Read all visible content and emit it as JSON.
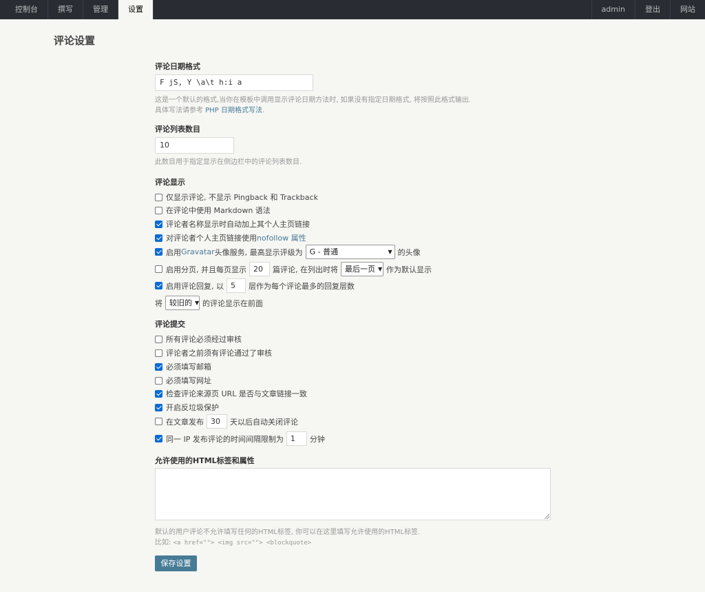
{
  "nav": {
    "left": [
      "控制台",
      "撰写",
      "管理",
      "设置"
    ],
    "right": [
      "admin",
      "登出",
      "网站"
    ]
  },
  "page_title": "评论设置",
  "date_format": {
    "title": "评论日期格式",
    "value": "F jS, Y \\a\\t h:i a",
    "desc1": "这是一个默认的格式,当你在模板中调用显示评论日期方法时, 如果没有指定日期格式, 将按照此格式输出.",
    "desc2_prefix": "具体写法请参考 ",
    "desc2_link": "PHP 日期格式写法",
    "desc2_suffix": "."
  },
  "list_count": {
    "title": "评论列表数目",
    "value": "10",
    "desc": "此数目用于指定显示在侧边栏中的评论列表数目."
  },
  "display": {
    "title": "评论显示",
    "opt1": "仅显示评论, 不显示 Pingback 和 Trackback",
    "opt2": "在评论中使用 Markdown 语法",
    "opt3": "评论者名称显示时自动加上其个人主页链接",
    "opt4_prefix": "对评论者个人主页链接使用 ",
    "opt4_link": "nofollow 属性",
    "opt5_prefix": "启用 ",
    "opt5_link": "Gravatar",
    "opt5_mid": " 头像服务, 最高显示评级为",
    "opt5_select": "G - 普通",
    "opt5_suffix": "的头像",
    "opt6_prefix": "启用分页, 并且每页显示",
    "opt6_value": "20",
    "opt6_mid": "篇评论, 在列出时将",
    "opt6_select": "最后一页",
    "opt6_suffix": "作为默认显示",
    "opt7_prefix": "启用评论回复, 以",
    "opt7_value": "5",
    "opt7_suffix": "层作为每个评论最多的回复层数",
    "order_prefix": "将",
    "order_select": "较旧的",
    "order_suffix": "的评论显示在前面"
  },
  "submit": {
    "title": "评论提交",
    "opt1": "所有评论必须经过审核",
    "opt2": "评论者之前须有评论通过了审核",
    "opt3": "必须填写邮箱",
    "opt4": "必须填写网址",
    "opt5": "检查评论来源页 URL 是否与文章链接一致",
    "opt6": "开启反垃圾保护",
    "opt7_prefix": "在文章发布",
    "opt7_value": "30",
    "opt7_suffix": "天以后自动关闭评论",
    "opt8_prefix": "同一 IP 发布评论的时间间隔限制为",
    "opt8_value": "1",
    "opt8_suffix": "分钟"
  },
  "html_tags": {
    "title": "允许使用的HTML标签和属性",
    "value": "",
    "desc1": "默认的用户评论不允许填写任何的HTML标签, 你可以在这里填写允许使用的HTML标签.",
    "desc2_prefix": "比如: ",
    "desc2_code": "<a href=\"\"> <img src=\"\"> <blockquote>"
  },
  "save_label": "保存设置",
  "colors": {
    "accent": "#467b96",
    "checkbox": "#0b6bd6",
    "nav_bg": "#292d33"
  }
}
